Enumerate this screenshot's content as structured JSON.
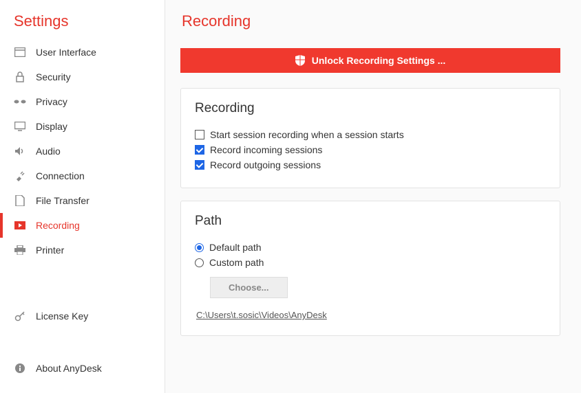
{
  "sidebar": {
    "title": "Settings",
    "items": [
      {
        "label": "User Interface"
      },
      {
        "label": "Security"
      },
      {
        "label": "Privacy"
      },
      {
        "label": "Display"
      },
      {
        "label": "Audio"
      },
      {
        "label": "Connection"
      },
      {
        "label": "File Transfer"
      },
      {
        "label": "Recording"
      },
      {
        "label": "Printer"
      }
    ],
    "license": {
      "label": "License Key"
    },
    "about": {
      "label": "About AnyDesk"
    }
  },
  "main": {
    "title": "Recording",
    "unlock_label": "Unlock Recording Settings ...",
    "recording_card": {
      "title": "Recording",
      "opt_start": "Start session recording when a session starts",
      "opt_incoming": "Record incoming sessions",
      "opt_outgoing": "Record outgoing sessions"
    },
    "path_card": {
      "title": "Path",
      "default_label": "Default path",
      "custom_label": "Custom path",
      "choose_label": "Choose...",
      "path_value": "C:\\Users\\t.sosic\\Videos\\AnyDesk"
    }
  }
}
